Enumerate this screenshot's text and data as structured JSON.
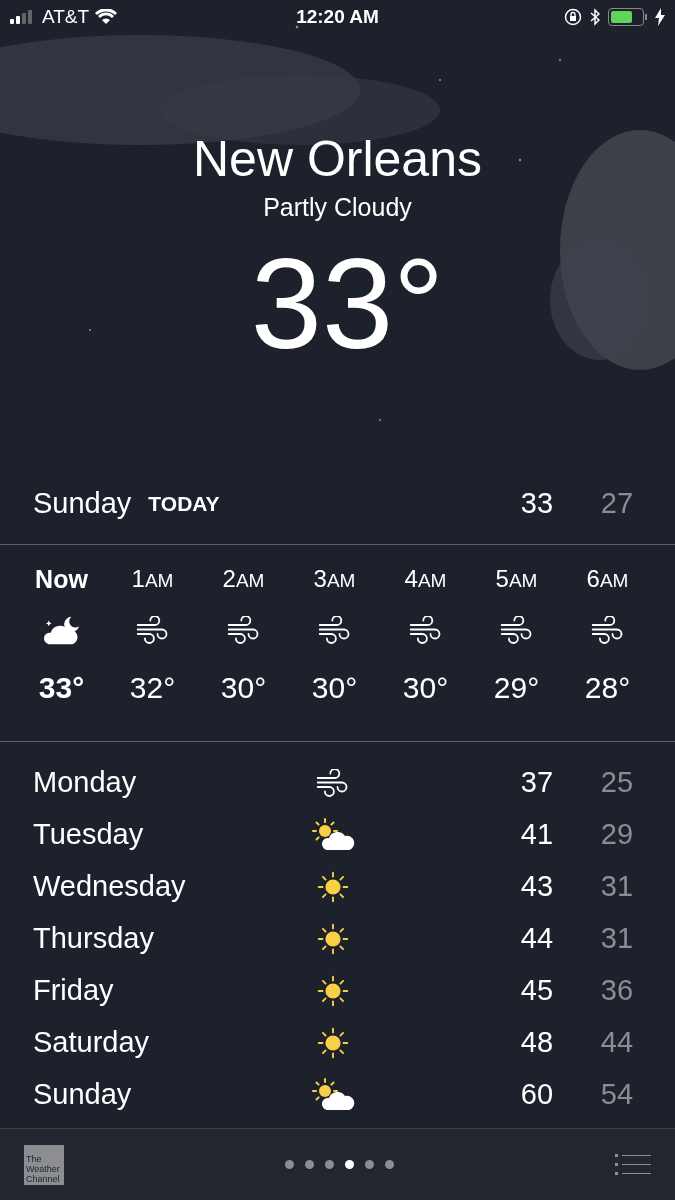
{
  "status_bar": {
    "carrier": "AT&T",
    "time": "12:20 AM"
  },
  "header": {
    "city": "New Orleans",
    "condition": "Partly Cloudy",
    "temperature": "33°"
  },
  "today": {
    "day": "Sunday",
    "label": "TODAY",
    "high": "33",
    "low": "27"
  },
  "hourly": [
    {
      "time": "Now",
      "current": true,
      "kind": "moon-cloud",
      "temp": "33°"
    },
    {
      "time": "1",
      "suffix": "AM",
      "current": false,
      "kind": "wind",
      "temp": "32°"
    },
    {
      "time": "2",
      "suffix": "AM",
      "current": false,
      "kind": "wind",
      "temp": "30°"
    },
    {
      "time": "3",
      "suffix": "AM",
      "current": false,
      "kind": "wind",
      "temp": "30°"
    },
    {
      "time": "4",
      "suffix": "AM",
      "current": false,
      "kind": "wind",
      "temp": "30°"
    },
    {
      "time": "5",
      "suffix": "AM",
      "current": false,
      "kind": "wind",
      "temp": "29°"
    },
    {
      "time": "6",
      "suffix": "AM",
      "current": false,
      "kind": "wind",
      "temp": "28°"
    }
  ],
  "daily": [
    {
      "day": "Monday",
      "kind": "wind",
      "high": "37",
      "low": "25"
    },
    {
      "day": "Tuesday",
      "kind": "sun-cloud",
      "high": "41",
      "low": "29"
    },
    {
      "day": "Wednesday",
      "kind": "sun",
      "high": "43",
      "low": "31"
    },
    {
      "day": "Thursday",
      "kind": "sun",
      "high": "44",
      "low": "31"
    },
    {
      "day": "Friday",
      "kind": "sun",
      "high": "45",
      "low": "36"
    },
    {
      "day": "Saturday",
      "kind": "sun",
      "high": "48",
      "low": "44"
    },
    {
      "day": "Sunday",
      "kind": "sun-cloud",
      "high": "60",
      "low": "54"
    }
  ],
  "footer": {
    "logo": "The Weather Channel",
    "pages": [
      {
        "selected": false
      },
      {
        "selected": false
      },
      {
        "selected": false
      },
      {
        "selected": true
      },
      {
        "selected": false
      },
      {
        "selected": false
      }
    ]
  }
}
